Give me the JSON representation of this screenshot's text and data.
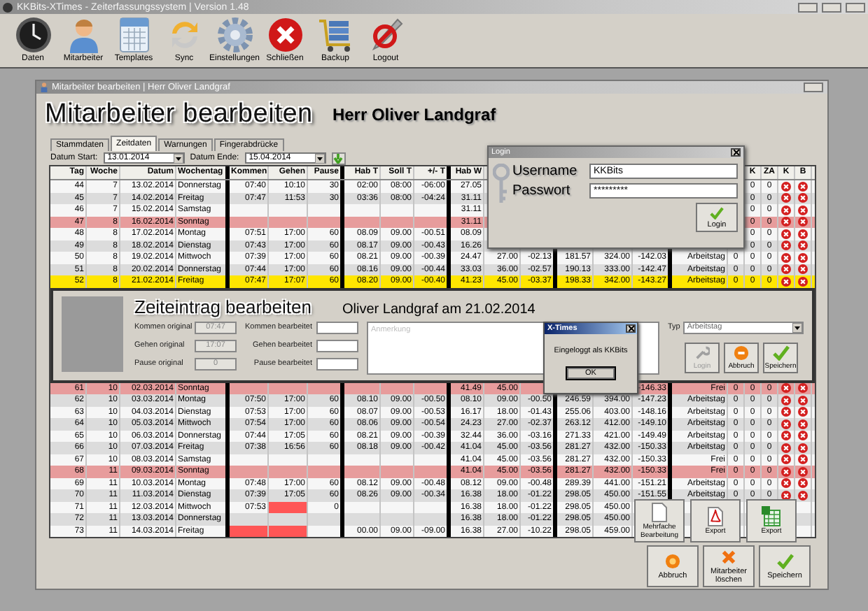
{
  "app_window": {
    "title": "KKBits-XTimes - Zeiterfassungssystem | Version 1.48"
  },
  "toolbar": [
    {
      "label": "Daten"
    },
    {
      "label": "Mitarbeiter"
    },
    {
      "label": "Templates"
    },
    {
      "label": "Sync"
    },
    {
      "label": "Einstellungen"
    },
    {
      "label": "Schließen"
    },
    {
      "label": "Backup"
    },
    {
      "label": "Logout"
    }
  ],
  "child_window": {
    "title": "Mitarbeiter bearbeiten | Herr Oliver Landgraf",
    "heading": "Mitarbeiter bearbeiten",
    "subheading": "Herr  Oliver Landgraf"
  },
  "tabs": [
    {
      "label": "Stammdaten",
      "selected": false
    },
    {
      "label": "Zeitdaten",
      "selected": true
    },
    {
      "label": "Warnungen",
      "selected": false
    },
    {
      "label": "Fingerabdrücke",
      "selected": false
    }
  ],
  "date_filter": {
    "start_label": "Datum Start:",
    "start": "13.01.2014",
    "end_label": "Datum Ende:",
    "end": "15.04.2014"
  },
  "table": {
    "columns": [
      "Tag",
      "Woche",
      "Datum",
      "Wochentag",
      "Kommen",
      "Gehen",
      "Pause",
      "Hab T",
      "Soll T",
      "+/- T",
      "Hab W",
      null,
      null,
      null,
      null,
      null,
      null,
      null,
      "K",
      "ZA",
      "K",
      "B"
    ],
    "rows_top": [
      {
        "kind": "day",
        "selected": false,
        "kommen_missing": false,
        "gehen_missing": false,
        "icons": true,
        "cells": [
          "44",
          "7",
          "13.02.2014",
          "Donnerstag",
          "07:40",
          "10:10",
          "30",
          "02:00",
          "08:00",
          "-06:00",
          "27.05",
          null,
          null,
          null,
          null,
          null,
          null,
          null,
          "0",
          "0"
        ]
      },
      {
        "kind": "day",
        "selected": false,
        "kommen_missing": false,
        "gehen_missing": false,
        "icons": true,
        "cells": [
          "45",
          "7",
          "14.02.2014",
          "Freitag",
          "07:47",
          "11:53",
          "30",
          "03:36",
          "08:00",
          "-04:24",
          "31.11",
          null,
          null,
          null,
          null,
          null,
          null,
          null,
          "0",
          "0"
        ]
      },
      {
        "kind": "day",
        "selected": false,
        "kommen_missing": false,
        "gehen_missing": false,
        "icons": true,
        "cells": [
          "46",
          "7",
          "15.02.2014",
          "Samstag",
          null,
          null,
          null,
          null,
          null,
          null,
          "31.11",
          null,
          null,
          null,
          null,
          null,
          null,
          null,
          "0",
          "0"
        ]
      },
      {
        "kind": "sunday",
        "selected": false,
        "kommen_missing": false,
        "gehen_missing": false,
        "icons": true,
        "cells": [
          "47",
          "8",
          "16.02.2014",
          "Sonntag",
          null,
          null,
          null,
          null,
          null,
          null,
          "31.11",
          null,
          null,
          null,
          null,
          null,
          null,
          null,
          "0",
          "0"
        ]
      },
      {
        "kind": "day",
        "selected": false,
        "kommen_missing": false,
        "gehen_missing": false,
        "icons": true,
        "cells": [
          "48",
          "8",
          "17.02.2014",
          "Montag",
          "07:51",
          "17:00",
          "60",
          "08.09",
          "09.00",
          "-00.51",
          "08.09",
          null,
          null,
          null,
          null,
          null,
          null,
          null,
          "0",
          "0"
        ]
      },
      {
        "kind": "day",
        "selected": false,
        "kommen_missing": false,
        "gehen_missing": false,
        "icons": true,
        "cells": [
          "49",
          "8",
          "18.02.2014",
          "Dienstag",
          "07:43",
          "17:00",
          "60",
          "08.17",
          "09.00",
          "-00.43",
          "16.26",
          null,
          null,
          null,
          null,
          null,
          null,
          null,
          "0",
          "0"
        ]
      },
      {
        "kind": "day",
        "selected": false,
        "kommen_missing": false,
        "gehen_missing": false,
        "icons": true,
        "cells": [
          "50",
          "8",
          "19.02.2014",
          "Mittwoch",
          "07:39",
          "17:00",
          "60",
          "08.21",
          "09.00",
          "-00.39",
          "24.47",
          "27.00",
          "-02.13",
          "181.57",
          "324.00",
          "-142.03",
          "Arbeitstag",
          "0",
          "0",
          "0"
        ]
      },
      {
        "kind": "day",
        "selected": false,
        "kommen_missing": false,
        "gehen_missing": false,
        "icons": true,
        "cells": [
          "51",
          "8",
          "20.02.2014",
          "Donnerstag",
          "07:44",
          "17:00",
          "60",
          "08.16",
          "09.00",
          "-00.44",
          "33.03",
          "36.00",
          "-02.57",
          "190.13",
          "333.00",
          "-142.47",
          "Arbeitstag",
          "0",
          "0",
          "0"
        ]
      },
      {
        "kind": "day",
        "selected": true,
        "kommen_missing": false,
        "gehen_missing": false,
        "icons": true,
        "cells": [
          "52",
          "8",
          "21.02.2014",
          "Freitag",
          "07:47",
          "17:07",
          "60",
          "08.20",
          "09.00",
          "-00.40",
          "41.23",
          "45.00",
          "-03.37",
          "198.33",
          "342.00",
          "-143.27",
          "Arbeitstag",
          "0",
          "0",
          "0"
        ]
      }
    ],
    "rows_bottom": [
      {
        "kind": "sunday",
        "selected": false,
        "kommen_missing": false,
        "gehen_missing": false,
        "icons": true,
        "cells": [
          "61",
          "10",
          "02.03.2014",
          "Sonntag",
          null,
          null,
          null,
          null,
          null,
          null,
          "41.49",
          "45.00",
          null,
          null,
          null,
          "-146.33",
          "Frei",
          "0",
          "0",
          "0"
        ]
      },
      {
        "kind": "day",
        "selected": false,
        "kommen_missing": false,
        "gehen_missing": false,
        "icons": true,
        "cells": [
          "62",
          "10",
          "03.03.2014",
          "Montag",
          "07:50",
          "17:00",
          "60",
          "08.10",
          "09.00",
          "-00.50",
          "08.10",
          "09.00",
          "-00.50",
          "246.59",
          "394.00",
          "-147.23",
          "Arbeitstag",
          "0",
          "0",
          "0"
        ]
      },
      {
        "kind": "day",
        "selected": false,
        "kommen_missing": false,
        "gehen_missing": false,
        "icons": true,
        "cells": [
          "63",
          "10",
          "04.03.2014",
          "Dienstag",
          "07:53",
          "17:00",
          "60",
          "08.07",
          "09.00",
          "-00.53",
          "16.17",
          "18.00",
          "-01.43",
          "255.06",
          "403.00",
          "-148.16",
          "Arbeitstag",
          "0",
          "0",
          "0"
        ]
      },
      {
        "kind": "day",
        "selected": false,
        "kommen_missing": false,
        "gehen_missing": false,
        "icons": true,
        "cells": [
          "64",
          "10",
          "05.03.2014",
          "Mittwoch",
          "07:54",
          "17:00",
          "60",
          "08.06",
          "09.00",
          "-00.54",
          "24.23",
          "27.00",
          "-02.37",
          "263.12",
          "412.00",
          "-149.10",
          "Arbeitstag",
          "0",
          "0",
          "0"
        ]
      },
      {
        "kind": "day",
        "selected": false,
        "kommen_missing": false,
        "gehen_missing": false,
        "icons": true,
        "cells": [
          "65",
          "10",
          "06.03.2014",
          "Donnerstag",
          "07:44",
          "17:05",
          "60",
          "08.21",
          "09.00",
          "-00.39",
          "32.44",
          "36.00",
          "-03.16",
          "271.33",
          "421.00",
          "-149.49",
          "Arbeitstag",
          "0",
          "0",
          "0"
        ]
      },
      {
        "kind": "day",
        "selected": false,
        "kommen_missing": false,
        "gehen_missing": false,
        "icons": true,
        "cells": [
          "66",
          "10",
          "07.03.2014",
          "Freitag",
          "07:38",
          "16:56",
          "60",
          "08.18",
          "09.00",
          "-00.42",
          "41.04",
          "45.00",
          "-03.56",
          "281.27",
          "432.00",
          "-150.33",
          "Arbeitstag",
          "0",
          "0",
          "0"
        ]
      },
      {
        "kind": "day",
        "selected": false,
        "kommen_missing": false,
        "gehen_missing": false,
        "icons": true,
        "cells": [
          "67",
          "10",
          "08.03.2014",
          "Samstag",
          null,
          null,
          null,
          null,
          null,
          null,
          "41.04",
          "45.00",
          "-03.56",
          "281.27",
          "432.00",
          "-150.33",
          "Frei",
          "0",
          "0",
          "0"
        ]
      },
      {
        "kind": "sunday",
        "selected": false,
        "kommen_missing": false,
        "gehen_missing": false,
        "icons": true,
        "cells": [
          "68",
          "11",
          "09.03.2014",
          "Sonntag",
          null,
          null,
          null,
          null,
          null,
          null,
          "41.04",
          "45.00",
          "-03.56",
          "281.27",
          "432.00",
          "-150.33",
          "Frei",
          "0",
          "0",
          "0"
        ]
      },
      {
        "kind": "day",
        "selected": false,
        "kommen_missing": false,
        "gehen_missing": false,
        "icons": true,
        "cells": [
          "69",
          "11",
          "10.03.2014",
          "Montag",
          "07:48",
          "17:00",
          "60",
          "08.12",
          "09.00",
          "-00.48",
          "08.12",
          "09.00",
          "-00.48",
          "289.39",
          "441.00",
          "-151.21",
          "Arbeitstag",
          "0",
          "0",
          "0"
        ]
      },
      {
        "kind": "day",
        "selected": false,
        "kommen_missing": false,
        "gehen_missing": false,
        "icons": true,
        "cells": [
          "70",
          "11",
          "11.03.2014",
          "Dienstag",
          "07:39",
          "17:05",
          "60",
          "08.26",
          "09.00",
          "-00.34",
          "16.38",
          "18.00",
          "-01.22",
          "298.05",
          "450.00",
          "-151.55",
          "Arbeitstag",
          "0",
          "0",
          "0"
        ]
      },
      {
        "kind": "day",
        "selected": false,
        "kommen_missing": false,
        "gehen_missing": true,
        "icons": false,
        "cells": [
          "71",
          "11",
          "12.03.2014",
          "Mittwoch",
          "07:53",
          null,
          "0",
          null,
          null,
          null,
          "16.38",
          "18.00",
          "-01.22",
          "298.05",
          "450.00",
          null,
          null,
          null,
          null,
          null
        ]
      },
      {
        "kind": "day",
        "selected": false,
        "kommen_missing": false,
        "gehen_missing": false,
        "icons": false,
        "cells": [
          "72",
          "11",
          "13.03.2014",
          "Donnerstag",
          null,
          null,
          null,
          null,
          null,
          null,
          "16.38",
          "18.00",
          "-01.22",
          "298.05",
          "450.00",
          null,
          null,
          null,
          null,
          null
        ]
      },
      {
        "kind": "day",
        "selected": false,
        "kommen_missing": true,
        "gehen_missing": true,
        "icons": false,
        "cells": [
          "73",
          "11",
          "14.03.2014",
          "Freitag",
          null,
          null,
          null,
          "00.00",
          "09.00",
          "-09.00",
          "16.38",
          "27.00",
          "-10.22",
          "298.05",
          "459.00",
          null,
          null,
          null,
          null,
          null
        ]
      }
    ]
  },
  "entry_editor": {
    "title": "Zeiteintrag bearbeiten",
    "subtitle": "Oliver Landgraf am 21.02.2014",
    "original_fields": [
      {
        "label": "Kommen original",
        "value": "07:47"
      },
      {
        "label": "Gehen original",
        "value": "17:07"
      },
      {
        "label": "Pause original",
        "value": "0"
      }
    ],
    "edited_fields": [
      {
        "label": "Kommen bearbeitet"
      },
      {
        "label": "Gehen bearbeitet"
      },
      {
        "label": "Pause bearbeitet"
      }
    ],
    "note": {
      "placeholder": "Anmerkung"
    },
    "type_label": "Typ",
    "type_value": "Arbeitstag",
    "buttons": [
      {
        "label": "Login",
        "disabled": true
      },
      {
        "label": "Abbruch",
        "disabled": false
      },
      {
        "label": "Speichern",
        "disabled": false
      }
    ]
  },
  "login_dialog": {
    "title": "Login",
    "username_label": "Username",
    "username": "KKBits",
    "password_label": "Passwort",
    "password": "*********",
    "button": "Login"
  },
  "message_box": {
    "title": "X-Times",
    "message": "Eingeloggt als KKBits",
    "button": "OK"
  },
  "table_actions": [
    {
      "label": "Mehrfache Bearbeitung"
    },
    {
      "label": "Export"
    },
    {
      "label": "Export"
    }
  ],
  "footer_buttons": [
    {
      "label": "Abbruch"
    },
    {
      "label": "Mitarbeiter löschen"
    },
    {
      "label": "Speichern"
    }
  ]
}
